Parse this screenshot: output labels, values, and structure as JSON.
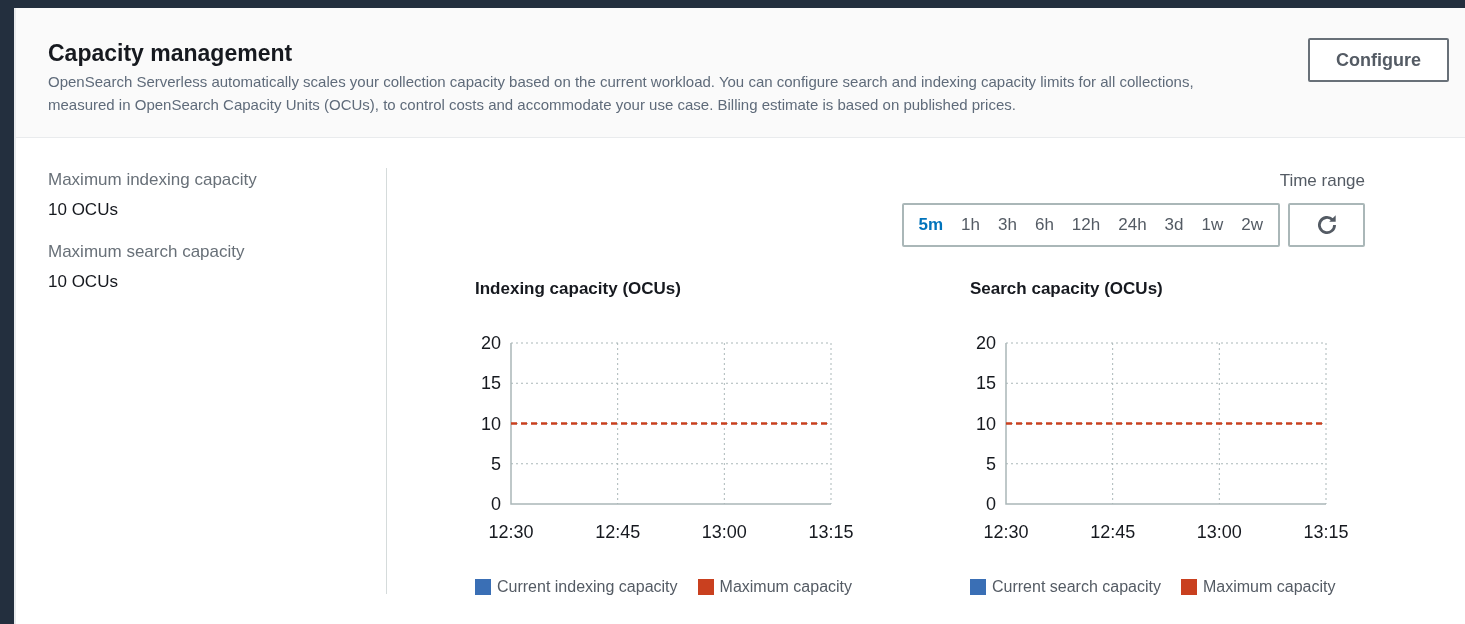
{
  "panel": {
    "title": "Capacity management",
    "description": "OpenSearch Serverless automatically scales your collection capacity based on the current workload. You can configure search and indexing capacity limits for all collections, measured in OpenSearch Capacity Units (OCUs), to control costs and accommodate your use case. Billing estimate is based on published prices.",
    "configure_button": "Configure"
  },
  "limits": [
    {
      "label": "Maximum indexing capacity",
      "value": "10 OCUs"
    },
    {
      "label": "Maximum search capacity",
      "value": "10 OCUs"
    }
  ],
  "time_range": {
    "label": "Time range",
    "options": [
      {
        "label": "5m",
        "selected": true
      },
      {
        "label": "1h",
        "selected": false
      },
      {
        "label": "3h",
        "selected": false
      },
      {
        "label": "6h",
        "selected": false
      },
      {
        "label": "12h",
        "selected": false
      },
      {
        "label": "24h",
        "selected": false
      },
      {
        "label": "3d",
        "selected": false
      },
      {
        "label": "1w",
        "selected": false
      },
      {
        "label": "2w",
        "selected": false
      }
    ]
  },
  "charts": [
    {
      "chart_data": {
        "type": "line",
        "title": "Indexing capacity (OCUs)",
        "grid": true,
        "categories": [
          "12:30",
          "12:45",
          "13:00",
          "13:15"
        ],
        "ylim": [
          0,
          20
        ],
        "yticks": [
          0,
          5,
          10,
          15,
          20
        ],
        "series": [
          {
            "name": "Current indexing capacity",
            "color": "#3a6fb5",
            "values": [
              null,
              null,
              null,
              null
            ]
          },
          {
            "name": "Maximum capacity",
            "color": "#c9401f",
            "line_style": "dashed",
            "values": [
              10,
              10,
              10,
              10
            ]
          }
        ]
      }
    },
    {
      "chart_data": {
        "type": "line",
        "title": "Search capacity (OCUs)",
        "grid": true,
        "categories": [
          "12:30",
          "12:45",
          "13:00",
          "13:15"
        ],
        "ylim": [
          0,
          20
        ],
        "yticks": [
          0,
          5,
          10,
          15,
          20
        ],
        "series": [
          {
            "name": "Current search capacity",
            "color": "#3a6fb5",
            "values": [
              null,
              null,
              null,
              null
            ]
          },
          {
            "name": "Maximum capacity",
            "color": "#c9401f",
            "line_style": "dashed",
            "values": [
              10,
              10,
              10,
              10
            ]
          }
        ]
      }
    }
  ]
}
